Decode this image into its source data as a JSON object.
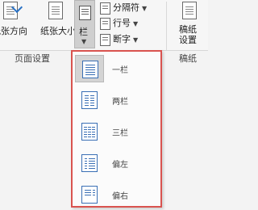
{
  "ribbon": {
    "orientation_label": "纸张方向",
    "size_label": "纸张大小",
    "columns_label": "栏",
    "breaks_label": "分隔符",
    "line_numbers_label": "行号",
    "hyphenation_label": "断字",
    "manuscript_label": "稿纸设置",
    "page_setup_group": "页面设置",
    "manuscript_group": "稿纸"
  },
  "menu": {
    "items": [
      {
        "label": "一栏",
        "selected": true
      },
      {
        "label": "两栏",
        "selected": false
      },
      {
        "label": "三栏",
        "selected": false
      },
      {
        "label": "偏左",
        "selected": false
      },
      {
        "label": "偏右",
        "selected": false
      }
    ]
  },
  "colors": {
    "accent": "#3a6fb5",
    "highlight_border": "#d9534f"
  }
}
